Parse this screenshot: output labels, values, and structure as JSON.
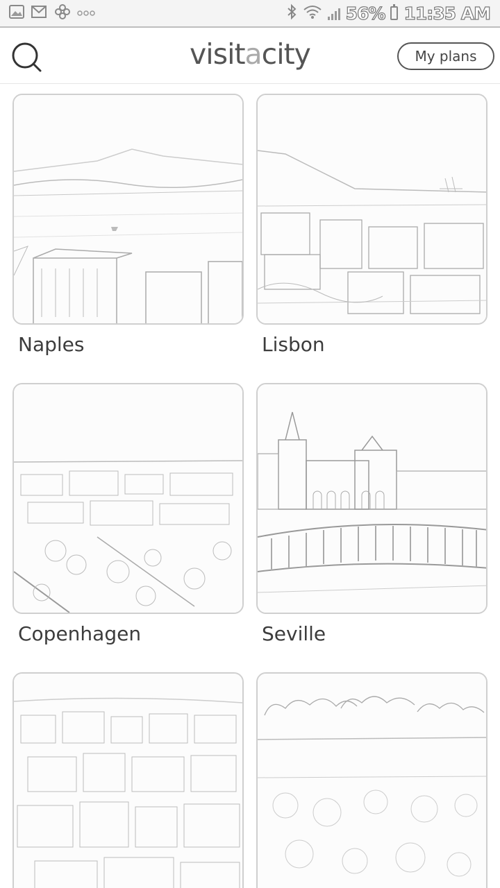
{
  "status_bar": {
    "battery": "56%",
    "time": "11:35 AM",
    "left_icons": [
      "image-icon",
      "gmail-icon",
      "flower-icon",
      "more-icon"
    ],
    "right_icons": [
      "bluetooth-icon",
      "wifi-icon",
      "signal-icon",
      "battery-icon"
    ]
  },
  "header": {
    "logo_part1": "visit",
    "logo_part2": "a",
    "logo_part3": "city",
    "my_plans_label": "My plans",
    "search_icon": "search-icon"
  },
  "cities": [
    {
      "name": "Naples"
    },
    {
      "name": "Lisbon"
    },
    {
      "name": "Copenhagen"
    },
    {
      "name": "Seville"
    },
    {
      "name": ""
    },
    {
      "name": ""
    }
  ]
}
